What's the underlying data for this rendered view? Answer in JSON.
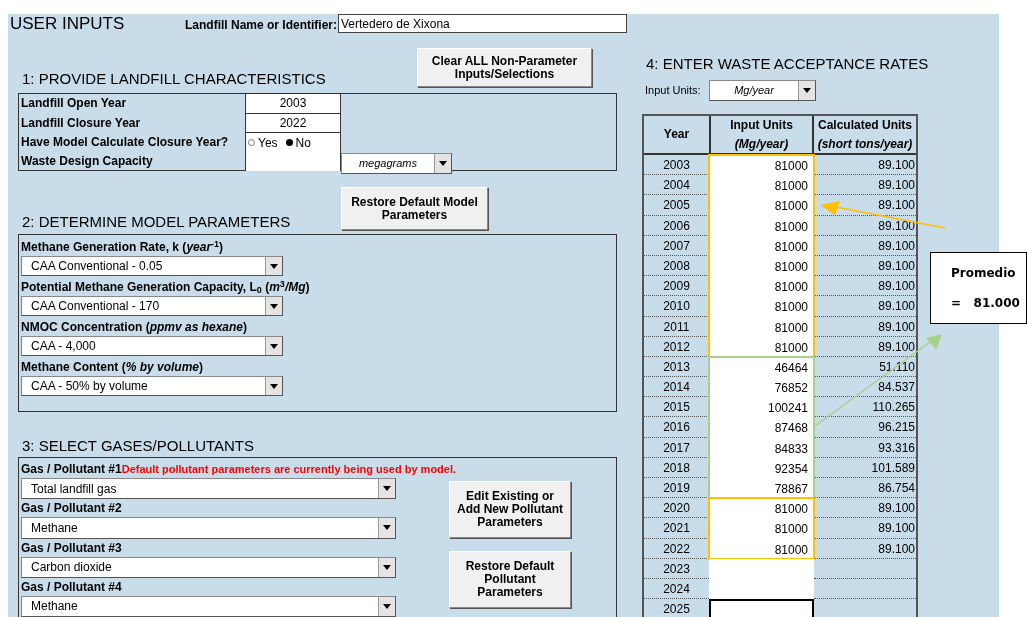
{
  "title": "USER INPUTS",
  "landfill_name": {
    "label": "Landfill Name or Identifier:",
    "value": "Vertedero de Xixona"
  },
  "section_1": {
    "title": "1: PROVIDE LANDFILL CHARACTERISTICS",
    "button": "Clear ALL Non-Parameter Inputs/Selections",
    "fields": [
      {
        "kind": "text",
        "label": "Landfill Open Year",
        "value": "2003"
      },
      {
        "kind": "text",
        "label": "Landfill Closure Year",
        "value": "2022"
      },
      {
        "kind": "radio",
        "label": "Have Model Calculate Closure Year?",
        "options": [
          {
            "label": "Yes",
            "selected": false
          },
          {
            "label": "No",
            "selected": true
          }
        ]
      },
      {
        "kind": "dropdown",
        "label": "Waste Design Capacity",
        "unit": "megagrams"
      }
    ]
  },
  "section_2": {
    "title": "2: DETERMINE MODEL PARAMETERS",
    "button": "Restore Default Model Parameters",
    "parameters": [
      {
        "label": "Methane Generation Rate, k (*year*$^{-1}$)",
        "value": "CAA Conventional - 0.05"
      },
      {
        "label": "Potential Methane Generation Capacity, L$_{0}$ (*m*$^{3}$*/Mg*)",
        "value": "CAA Conventional - 170"
      },
      {
        "label": "NMOC Concentration (*ppmv as hexane*)",
        "value": "CAA - 4,000"
      },
      {
        "label": "Methane Content (*% by volume*)",
        "value": "CAA - 50% by volume"
      }
    ]
  },
  "section_3": {
    "title": "3: SELECT GASES/POLLUTANTS",
    "notice": "Default pollutant parameters are currently being used by model.",
    "pollutants": [
      {
        "label": "Gas / Pollutant #1",
        "value": "Total landfill gas"
      },
      {
        "label": "Gas / Pollutant #2",
        "value": "Methane"
      },
      {
        "label": "Gas / Pollutant #3",
        "value": "Carbon dioxide"
      },
      {
        "label": "Gas / Pollutant #4",
        "value": "Methane"
      }
    ],
    "buttons": [
      "Edit Existing or Add New Pollutant Parameters",
      "Restore Default Pollutant Parameters"
    ]
  },
  "section_4": {
    "title": "4: ENTER WASTE ACCEPTANCE RATES",
    "input_units": {
      "label": "Input Units:",
      "value": "Mg/year"
    },
    "table": {
      "columns": [
        {
          "title": "Year"
        },
        {
          "title": "Input Units",
          "subtitle": "(Mg/year)"
        },
        {
          "title": "Calculated Units",
          "subtitle": "(short tons/year)"
        }
      ],
      "row_groups": [
        {
          "color": "#ffc000",
          "rows": [
            {
              "year": "2003",
              "input": "81000",
              "calculated": "89.100",
              "selected": false
            },
            {
              "year": "2004",
              "input": "81000",
              "calculated": "89.100",
              "selected": false
            },
            {
              "year": "2005",
              "input": "81000",
              "calculated": "89.100",
              "selected": false
            },
            {
              "year": "2006",
              "input": "81000",
              "calculated": "89.100",
              "selected": false
            },
            {
              "year": "2007",
              "input": "81000",
              "calculated": "89.100",
              "selected": false
            },
            {
              "year": "2008",
              "input": "81000",
              "calculated": "89.100",
              "selected": false
            },
            {
              "year": "2009",
              "input": "81000",
              "calculated": "89.100",
              "selected": false
            },
            {
              "year": "2010",
              "input": "81000",
              "calculated": "89.100",
              "selected": false
            },
            {
              "year": "2011",
              "input": "81000",
              "calculated": "89.100",
              "selected": false
            },
            {
              "year": "2012",
              "input": "81000",
              "calculated": "89.100",
              "selected": false
            }
          ]
        },
        {
          "color": "#a9d08e",
          "rows": [
            {
              "year": "2013",
              "input": "46464",
              "calculated": "51.110",
              "selected": false
            },
            {
              "year": "2014",
              "input": "76852",
              "calculated": "84.537",
              "selected": false
            },
            {
              "year": "2015",
              "input": "100241",
              "calculated": "110.265",
              "selected": false
            },
            {
              "year": "2016",
              "input": "87468",
              "calculated": "96.215",
              "selected": false
            },
            {
              "year": "2017",
              "input": "84833",
              "calculated": "93.316",
              "selected": false
            },
            {
              "year": "2018",
              "input": "92354",
              "calculated": "101.589",
              "selected": false
            },
            {
              "year": "2019",
              "input": "78867",
              "calculated": "86.754",
              "selected": false
            }
          ]
        },
        {
          "color": "#ffc000",
          "rows": [
            {
              "year": "2020",
              "input": "81000",
              "calculated": "89.100",
              "selected": false
            },
            {
              "year": "2021",
              "input": "81000",
              "calculated": "89.100",
              "selected": false
            },
            {
              "year": "2022",
              "input": "81000",
              "calculated": "89.100",
              "selected": false
            }
          ]
        },
        {
          "rows": [
            {
              "year": "2023",
              "selected": false
            },
            {
              "year": "2024",
              "selected": false
            },
            {
              "year": "2025",
              "selected": true
            }
          ]
        }
      ]
    }
  },
  "annotation": {
    "title": "Promedio",
    "value": "=   81.000"
  }
}
